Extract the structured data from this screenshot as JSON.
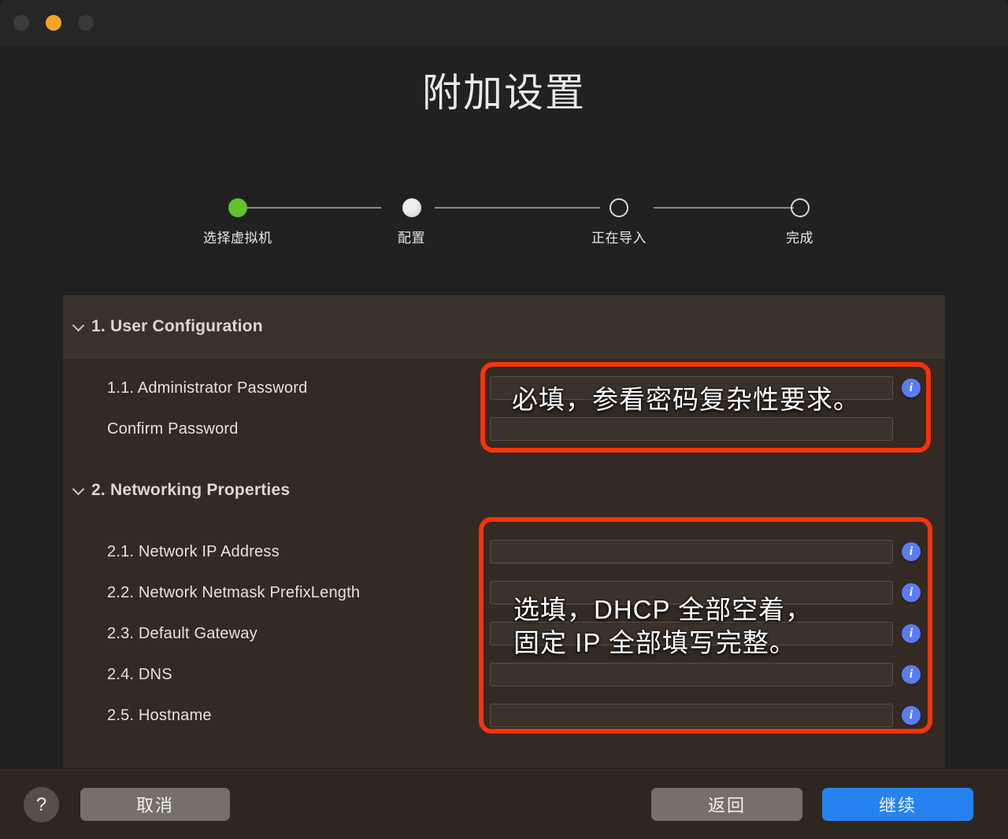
{
  "window": {
    "traffic_lights": [
      "close",
      "minimize",
      "zoom"
    ]
  },
  "page": {
    "title": "附加设置"
  },
  "stepper": {
    "steps": [
      {
        "label": "选择虚拟机",
        "state": "done"
      },
      {
        "label": "配置",
        "state": "current"
      },
      {
        "label": "正在导入",
        "state": "todo"
      },
      {
        "label": "完成",
        "state": "todo"
      }
    ]
  },
  "panel": {
    "sections": [
      {
        "id": "user-configuration",
        "title": "1. User Configuration",
        "expanded": true,
        "rows": [
          {
            "label": "1.1. Administrator Password",
            "value": "",
            "has_field": true,
            "has_info": true
          },
          {
            "label": "Confirm Password",
            "value": "",
            "has_field": true,
            "has_info": false
          }
        ]
      },
      {
        "id": "networking-properties",
        "title": "2. Networking Properties",
        "expanded": true,
        "rows": [
          {
            "label": "2.1. Network IP Address",
            "value": "",
            "has_field": true,
            "has_info": true
          },
          {
            "label": "2.2. Network Netmask PrefixLength",
            "value": "",
            "has_field": true,
            "has_info": true
          },
          {
            "label": "2.3. Default Gateway",
            "value": "",
            "has_field": true,
            "has_info": true
          },
          {
            "label": "2.4. DNS",
            "value": "",
            "has_field": true,
            "has_info": true
          },
          {
            "label": "2.5. Hostname",
            "value": "",
            "has_field": true,
            "has_info": true
          }
        ]
      }
    ]
  },
  "annotations": [
    {
      "id": "password-annotation",
      "text": "必填，参看密码复杂性要求。",
      "color": "#f6330a"
    },
    {
      "id": "networking-annotation",
      "text": "选填，DHCP 全部空着，\n固定 IP 全部填写完整。",
      "color": "#f6330a"
    }
  ],
  "footer": {
    "help_label": "?",
    "cancel_label": "取消",
    "back_label": "返回",
    "continue_label": "继续"
  },
  "icons": {
    "info": "i",
    "chevron_down": "chevron-down-icon"
  },
  "colors": {
    "accent_primary": "#2682f0",
    "annotation_red": "#f6330a",
    "step_done_green": "#61c12e",
    "info_blue": "#5b7cf0",
    "panel_bg": "#332a23"
  }
}
